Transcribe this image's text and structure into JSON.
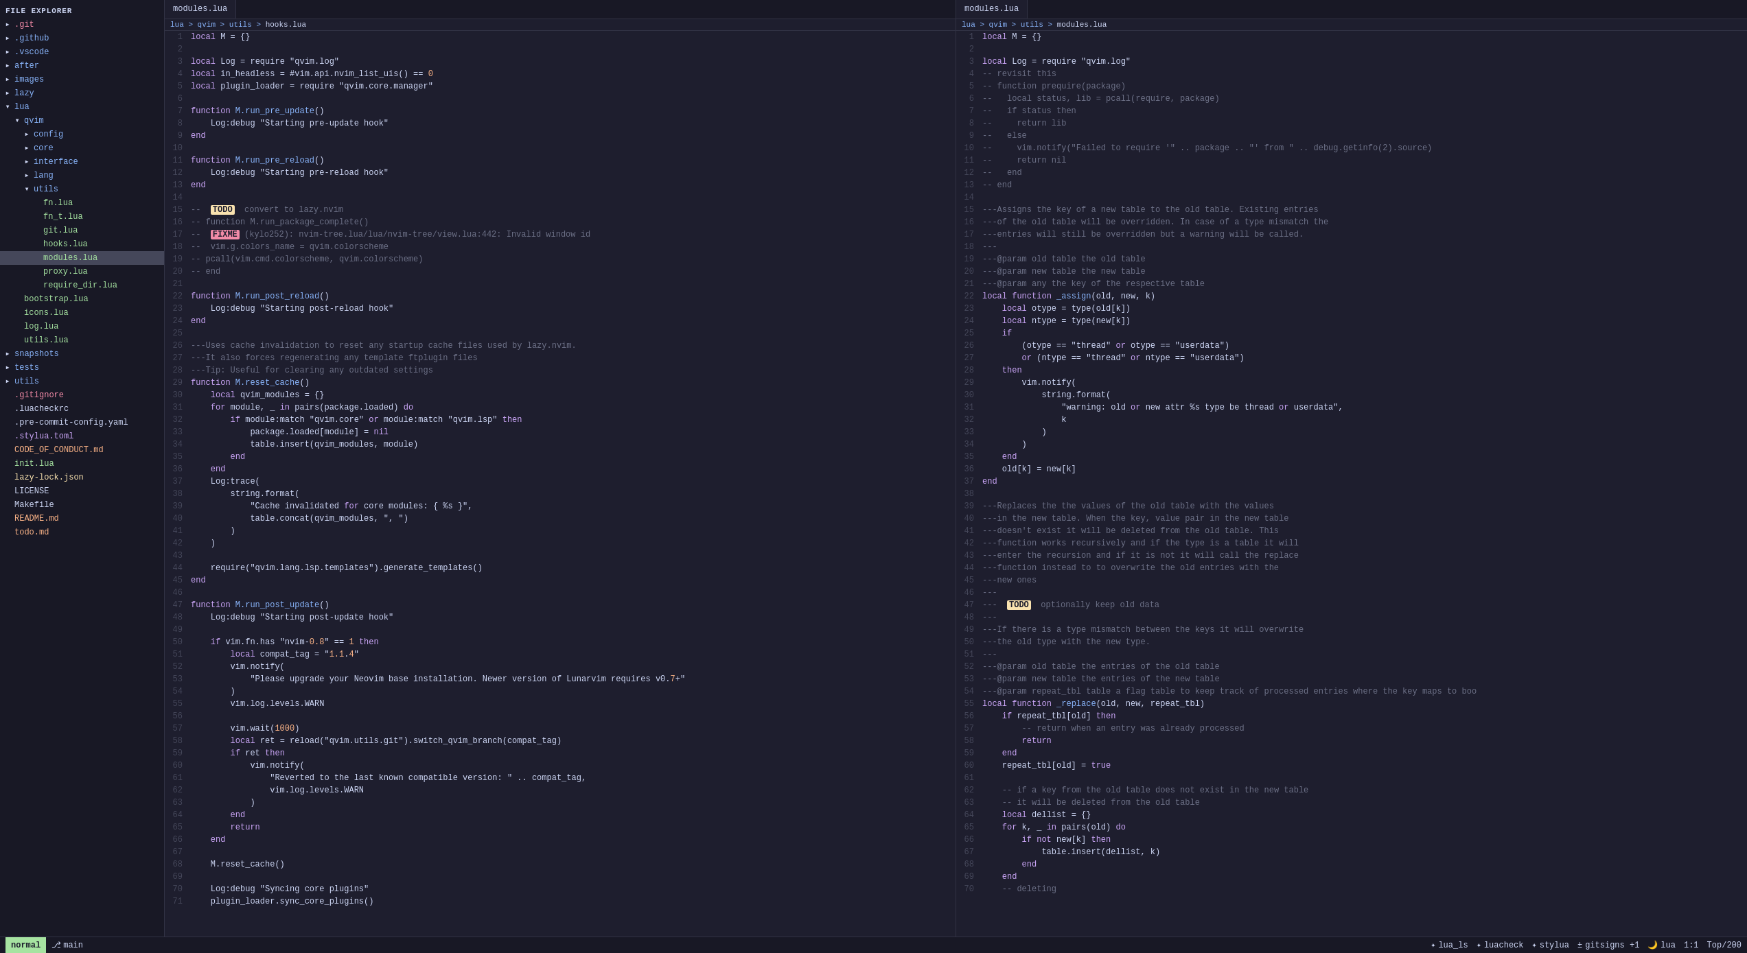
{
  "sidebar": {
    "title": "File Explorer",
    "items": [
      {
        "id": "git",
        "label": ".git",
        "indent": 1,
        "icon": "▸",
        "color": "git-color",
        "type": "folder"
      },
      {
        "id": "github",
        "label": ".github",
        "indent": 1,
        "icon": "▸",
        "color": "folder-color",
        "type": "folder"
      },
      {
        "id": "vscode",
        "label": ".vscode",
        "indent": 1,
        "icon": "▸",
        "color": "folder-color",
        "type": "folder"
      },
      {
        "id": "after",
        "label": "after",
        "indent": 1,
        "icon": "▸",
        "color": "folder-color",
        "type": "folder"
      },
      {
        "id": "images",
        "label": "images",
        "indent": 1,
        "icon": "▸",
        "color": "folder-color",
        "type": "folder"
      },
      {
        "id": "lazy",
        "label": "lazy",
        "indent": 1,
        "icon": "▸",
        "color": "folder-color",
        "type": "folder"
      },
      {
        "id": "lua",
        "label": "lua",
        "indent": 1,
        "icon": "▾",
        "color": "folder-color",
        "type": "folder-open"
      },
      {
        "id": "qvim",
        "label": "qvim",
        "indent": 2,
        "icon": "▾",
        "color": "folder-color",
        "type": "folder-open"
      },
      {
        "id": "config",
        "label": "config",
        "indent": 3,
        "icon": "▸",
        "color": "folder-color",
        "type": "folder"
      },
      {
        "id": "core",
        "label": "core",
        "indent": 3,
        "icon": "▸",
        "color": "folder-color",
        "type": "folder"
      },
      {
        "id": "interface",
        "label": "interface",
        "indent": 3,
        "icon": "▸",
        "color": "folder-color",
        "type": "folder"
      },
      {
        "id": "lang",
        "label": "lang",
        "indent": 3,
        "icon": "▸",
        "color": "folder-color",
        "type": "folder"
      },
      {
        "id": "utils",
        "label": "utils",
        "indent": 3,
        "icon": "▾",
        "color": "folder-color",
        "type": "folder-open"
      },
      {
        "id": "fn-lua",
        "label": "fn.lua",
        "indent": 4,
        "icon": " ",
        "color": "lua-color",
        "type": "file"
      },
      {
        "id": "fn_t-lua",
        "label": "fn_t.lua",
        "indent": 4,
        "icon": " ",
        "color": "lua-color",
        "type": "file"
      },
      {
        "id": "git-lua",
        "label": "git.lua",
        "indent": 4,
        "icon": " ",
        "color": "lua-color",
        "type": "file"
      },
      {
        "id": "hooks-lua",
        "label": "hooks.lua",
        "indent": 4,
        "icon": " ",
        "color": "lua-color",
        "type": "file"
      },
      {
        "id": "modules-lua",
        "label": "modules.lua",
        "indent": 4,
        "icon": " ",
        "color": "lua-color",
        "type": "file",
        "active": true
      },
      {
        "id": "proxy-lua",
        "label": "proxy.lua",
        "indent": 4,
        "icon": " ",
        "color": "lua-color",
        "type": "file"
      },
      {
        "id": "require_dir-lua",
        "label": "require_dir.lua",
        "indent": 4,
        "icon": " ",
        "color": "lua-color",
        "type": "file"
      },
      {
        "id": "bootstrap-lua",
        "label": "bootstrap.lua",
        "indent": 2,
        "icon": " ",
        "color": "lua-color",
        "type": "file"
      },
      {
        "id": "icons-lua",
        "label": "icons.lua",
        "indent": 2,
        "icon": " ",
        "color": "lua-color",
        "type": "file"
      },
      {
        "id": "log-lua",
        "label": "log.lua",
        "indent": 2,
        "icon": " ",
        "color": "lua-color",
        "type": "file"
      },
      {
        "id": "utils-lua",
        "label": "utils.lua",
        "indent": 2,
        "icon": " ",
        "color": "lua-color",
        "type": "file"
      },
      {
        "id": "snapshots",
        "label": "snapshots",
        "indent": 1,
        "icon": "▸",
        "color": "folder-color",
        "type": "folder"
      },
      {
        "id": "tests",
        "label": "tests",
        "indent": 1,
        "icon": "▸",
        "color": "folder-color",
        "type": "folder"
      },
      {
        "id": "utils2",
        "label": "utils",
        "indent": 1,
        "icon": "▸",
        "color": "folder-color",
        "type": "folder"
      },
      {
        "id": "gitignore",
        "label": ".gitignore",
        "indent": 1,
        "icon": " ",
        "color": "git-color",
        "type": "file"
      },
      {
        "id": "luacheckrc",
        "label": ".luacheckrc",
        "indent": 1,
        "icon": " ",
        "color": "txt-color",
        "type": "file"
      },
      {
        "id": "pre-commit",
        "label": ".pre-commit-config.yaml",
        "indent": 1,
        "icon": " ",
        "color": "txt-color",
        "type": "file"
      },
      {
        "id": "stylua",
        "label": ".stylua.toml",
        "indent": 1,
        "icon": " ",
        "color": "toml-color",
        "type": "file"
      },
      {
        "id": "code_of_conduct",
        "label": "CODE_OF_CONDUCT.md",
        "indent": 1,
        "icon": " ",
        "color": "md-color",
        "type": "file"
      },
      {
        "id": "init-lua",
        "label": "init.lua",
        "indent": 1,
        "icon": " ",
        "color": "lua-color",
        "type": "file"
      },
      {
        "id": "lazy-lock",
        "label": "lazy-lock.json",
        "indent": 1,
        "icon": " ",
        "color": "json-color",
        "type": "file"
      },
      {
        "id": "license",
        "label": "LICENSE",
        "indent": 1,
        "icon": " ",
        "color": "txt-color",
        "type": "file"
      },
      {
        "id": "makefile",
        "label": "Makefile",
        "indent": 1,
        "icon": " ",
        "color": "txt-color",
        "type": "file"
      },
      {
        "id": "readme",
        "label": "README.md",
        "indent": 1,
        "icon": " ",
        "color": "md-color",
        "type": "file"
      },
      {
        "id": "todo",
        "label": "todo.md",
        "indent": 1,
        "icon": " ",
        "color": "md-color",
        "type": "file"
      }
    ]
  },
  "editor_left": {
    "tab_label": "modules.lua",
    "breadcrumb": [
      "lua",
      "qvim",
      "utils",
      "hooks.lua"
    ],
    "lines": [
      {
        "n": 1,
        "code": "local M = {}"
      },
      {
        "n": 2,
        "code": ""
      },
      {
        "n": 3,
        "code": "local Log = require \"qvim.log\""
      },
      {
        "n": 4,
        "code": "local in_headless = #vim.api.nvim_list_uis() == 0"
      },
      {
        "n": 5,
        "code": "local plugin_loader = require \"qvim.core.manager\""
      },
      {
        "n": 6,
        "code": ""
      },
      {
        "n": 7,
        "code": "function M.run_pre_update()"
      },
      {
        "n": 8,
        "code": "    Log:debug \"Starting pre-update hook\""
      },
      {
        "n": 9,
        "code": "end"
      },
      {
        "n": 10,
        "code": ""
      },
      {
        "n": 11,
        "code": "function M.run_pre_reload()"
      },
      {
        "n": 12,
        "code": "    Log:debug \"Starting pre-reload hook\""
      },
      {
        "n": 13,
        "code": "end"
      },
      {
        "n": 14,
        "code": ""
      },
      {
        "n": 15,
        "code": "--  TODO  convert to lazy.nvim"
      },
      {
        "n": 16,
        "code": "-- function M.run_package_complete()"
      },
      {
        "n": 17,
        "code": "--  FIXME (kylo252): nvim-tree.lua/lua/nvim-tree/view.lua:442: Invalid window id"
      },
      {
        "n": 18,
        "code": "--  vim.g.colors_name = qvim.colorscheme"
      },
      {
        "n": 19,
        "code": "-- pcall(vim.cmd.colorscheme, qvim.colorscheme)"
      },
      {
        "n": 20,
        "code": "-- end"
      },
      {
        "n": 21,
        "code": ""
      },
      {
        "n": 22,
        "code": "function M.run_post_reload()"
      },
      {
        "n": 23,
        "code": "    Log:debug \"Starting post-reload hook\""
      },
      {
        "n": 24,
        "code": "end"
      },
      {
        "n": 25,
        "code": ""
      },
      {
        "n": 26,
        "code": "---Uses cache invalidation to reset any startup cache files used by lazy.nvim."
      },
      {
        "n": 27,
        "code": "---It also forces regenerating any template ftplugin files"
      },
      {
        "n": 28,
        "code": "---Tip: Useful for clearing any outdated settings"
      },
      {
        "n": 29,
        "code": "function M.reset_cache()"
      },
      {
        "n": 30,
        "code": "    local qvim_modules = {}"
      },
      {
        "n": 31,
        "code": "    for module, _ in pairs(package.loaded) do"
      },
      {
        "n": 32,
        "code": "        if module:match \"qvim.core\" or module:match \"qvim.lsp\" then"
      },
      {
        "n": 33,
        "code": "            package.loaded[module] = nil"
      },
      {
        "n": 34,
        "code": "            table.insert(qvim_modules, module)"
      },
      {
        "n": 35,
        "code": "        end"
      },
      {
        "n": 36,
        "code": "    end"
      },
      {
        "n": 37,
        "code": "    Log:trace("
      },
      {
        "n": 38,
        "code": "        string.format("
      },
      {
        "n": 39,
        "code": "            \"Cache invalidated for core modules: { %s }\","
      },
      {
        "n": 40,
        "code": "            table.concat(qvim_modules, \", \")"
      },
      {
        "n": 41,
        "code": "        )"
      },
      {
        "n": 42,
        "code": "    )"
      },
      {
        "n": 43,
        "code": ""
      },
      {
        "n": 44,
        "code": "    require(\"qvim.lang.lsp.templates\").generate_templates()"
      },
      {
        "n": 45,
        "code": "end"
      },
      {
        "n": 46,
        "code": ""
      },
      {
        "n": 47,
        "code": "function M.run_post_update()"
      },
      {
        "n": 48,
        "code": "    Log:debug \"Starting post-update hook\""
      },
      {
        "n": 49,
        "code": ""
      },
      {
        "n": 50,
        "code": "    if vim.fn.has \"nvim-0.8\" == 1 then"
      },
      {
        "n": 51,
        "code": "        local compat_tag = \"1.1.4\""
      },
      {
        "n": 52,
        "code": "        vim.notify("
      },
      {
        "n": 53,
        "code": "            \"Please upgrade your Neovim base installation. Newer version of Lunarvim requires v0.7+\""
      },
      {
        "n": 54,
        "code": "        )"
      },
      {
        "n": 55,
        "code": "        vim.log.levels.WARN"
      },
      {
        "n": 56,
        "code": ""
      },
      {
        "n": 57,
        "code": "        vim.wait(1000)"
      },
      {
        "n": 58,
        "code": "        local ret = reload(\"qvim.utils.git\").switch_qvim_branch(compat_tag)"
      },
      {
        "n": 59,
        "code": "        if ret then"
      },
      {
        "n": 60,
        "code": "            vim.notify("
      },
      {
        "n": 61,
        "code": "                \"Reverted to the last known compatible version: \" .. compat_tag,"
      },
      {
        "n": 62,
        "code": "                vim.log.levels.WARN"
      },
      {
        "n": 63,
        "code": "            )"
      },
      {
        "n": 64,
        "code": "        end"
      },
      {
        "n": 65,
        "code": "        return"
      },
      {
        "n": 66,
        "code": "    end"
      },
      {
        "n": 67,
        "code": ""
      },
      {
        "n": 68,
        "code": "    M.reset_cache()"
      },
      {
        "n": 69,
        "code": ""
      },
      {
        "n": 70,
        "code": "    Log:debug \"Syncing core plugins\""
      },
      {
        "n": 71,
        "code": "    plugin_loader.sync_core_plugins()"
      }
    ]
  },
  "editor_right": {
    "tab_label": "modules.lua",
    "breadcrumb": [
      "lua",
      "qvim",
      "utils",
      "modules.lua"
    ],
    "lines": [
      {
        "n": 1,
        "code": "local M = {}"
      },
      {
        "n": 2,
        "code": ""
      },
      {
        "n": 3,
        "code": "local Log = require \"qvim.log\""
      },
      {
        "n": 4,
        "code": "-- revisit this"
      },
      {
        "n": 5,
        "code": "-- function prequire(package)"
      },
      {
        "n": 6,
        "code": "--   local status, lib = pcall(require, package)"
      },
      {
        "n": 7,
        "code": "--   if status then"
      },
      {
        "n": 8,
        "code": "--     return lib"
      },
      {
        "n": 9,
        "code": "--   else"
      },
      {
        "n": 10,
        "code": "--     vim.notify(\"Failed to require '\" .. package .. \"' from \" .. debug.getinfo(2).source)"
      },
      {
        "n": 11,
        "code": "--     return nil"
      },
      {
        "n": 12,
        "code": "--   end"
      },
      {
        "n": 13,
        "code": "-- end"
      },
      {
        "n": 14,
        "code": ""
      },
      {
        "n": 15,
        "code": "---Assigns the key of a new table to the old table. Existing entries"
      },
      {
        "n": 16,
        "code": "---of the old table will be overridden. In case of a type mismatch the"
      },
      {
        "n": 17,
        "code": "---entries will still be overridden but a warning will be called."
      },
      {
        "n": 18,
        "code": "---"
      },
      {
        "n": 19,
        "code": "---@param old table the old table"
      },
      {
        "n": 20,
        "code": "---@param new table the new table"
      },
      {
        "n": 21,
        "code": "---@param any the key of the respective table"
      },
      {
        "n": 22,
        "code": "local function _assign(old, new, k)"
      },
      {
        "n": 23,
        "code": "    local otype = type(old[k])"
      },
      {
        "n": 24,
        "code": "    local ntype = type(new[k])"
      },
      {
        "n": 25,
        "code": "    if"
      },
      {
        "n": 26,
        "code": "        (otype == \"thread\" or otype == \"userdata\")"
      },
      {
        "n": 27,
        "code": "        or (ntype == \"thread\" or ntype == \"userdata\")"
      },
      {
        "n": 28,
        "code": "    then"
      },
      {
        "n": 29,
        "code": "        vim.notify("
      },
      {
        "n": 30,
        "code": "            string.format("
      },
      {
        "n": 31,
        "code": "                \"warning: old or new attr %s type be thread or userdata\","
      },
      {
        "n": 32,
        "code": "                k"
      },
      {
        "n": 33,
        "code": "            )"
      },
      {
        "n": 34,
        "code": "        )"
      },
      {
        "n": 35,
        "code": "    end"
      },
      {
        "n": 36,
        "code": "    old[k] = new[k]"
      },
      {
        "n": 37,
        "code": "end"
      },
      {
        "n": 38,
        "code": ""
      },
      {
        "n": 39,
        "code": "---Replaces the the values of the old table with the values"
      },
      {
        "n": 40,
        "code": "---in the new table. When the key, value pair in the new table"
      },
      {
        "n": 41,
        "code": "---doesn't exist it will be deleted from the old table. This"
      },
      {
        "n": 42,
        "code": "---function works recursively and if the type is a table it will"
      },
      {
        "n": 43,
        "code": "---enter the recursion and if it is not it will call the replace"
      },
      {
        "n": 44,
        "code": "---function instead to to overwrite the old entries with the"
      },
      {
        "n": 45,
        "code": "---new ones"
      },
      {
        "n": 46,
        "code": "---"
      },
      {
        "n": 47,
        "code": "---  TODO  optionally keep old data"
      },
      {
        "n": 48,
        "code": "---"
      },
      {
        "n": 49,
        "code": "---If there is a type mismatch between the keys it will overwrite"
      },
      {
        "n": 50,
        "code": "---the old type with the new type."
      },
      {
        "n": 51,
        "code": "---"
      },
      {
        "n": 52,
        "code": "---@param old table the entries of the old table"
      },
      {
        "n": 53,
        "code": "---@param new table the entries of the new table"
      },
      {
        "n": 54,
        "code": "---@param repeat_tbl table a flag table to keep track of processed entries where the key maps to boo"
      },
      {
        "n": 55,
        "code": "local function _replace(old, new, repeat_tbl)"
      },
      {
        "n": 56,
        "code": "    if repeat_tbl[old] then"
      },
      {
        "n": 57,
        "code": "        -- return when an entry was already processed"
      },
      {
        "n": 58,
        "code": "        return"
      },
      {
        "n": 59,
        "code": "    end"
      },
      {
        "n": 60,
        "code": "    repeat_tbl[old] = true"
      },
      {
        "n": 61,
        "code": ""
      },
      {
        "n": 62,
        "code": "    -- if a key from the old table does not exist in the new table"
      },
      {
        "n": 63,
        "code": "    -- it will be deleted from the old table"
      },
      {
        "n": 64,
        "code": "    local dellist = {}"
      },
      {
        "n": 65,
        "code": "    for k, _ in pairs(old) do"
      },
      {
        "n": 66,
        "code": "        if not new[k] then"
      },
      {
        "n": 67,
        "code": "            table.insert(dellist, k)"
      },
      {
        "n": 68,
        "code": "        end"
      },
      {
        "n": 69,
        "code": "    end"
      },
      {
        "n": 70,
        "code": "    -- deleting"
      }
    ]
  },
  "statusbar": {
    "mode": "normal",
    "branch_icon": "⎇",
    "branch": "main",
    "lsp_items": [
      {
        "icon": "✦",
        "name": "lua_ls"
      },
      {
        "icon": "✦",
        "name": "luacheck"
      },
      {
        "icon": "✦",
        "name": "stylua"
      },
      {
        "icon": "±",
        "name": "gitsigns +1"
      }
    ],
    "filetype": "lua",
    "position": "1:1",
    "scroll": "Top/200"
  }
}
